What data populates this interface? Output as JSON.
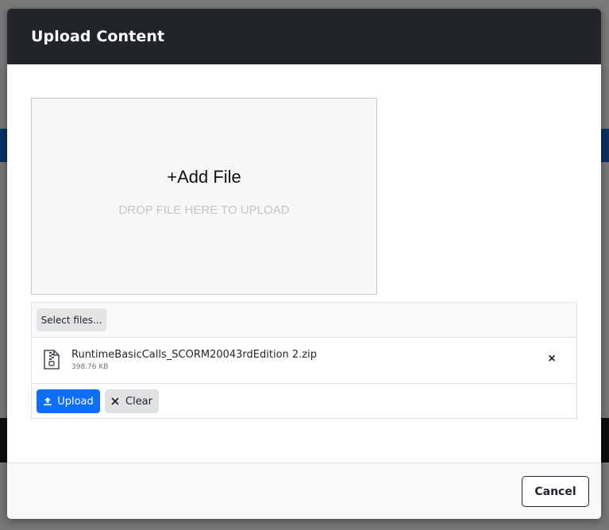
{
  "modal": {
    "title": "Upload Content"
  },
  "dropzone": {
    "add_label": "+Add File",
    "hint": "DROP FILE HERE TO UPLOAD"
  },
  "uploader": {
    "select_label": "Select files...",
    "files": [
      {
        "name": "RuntimeBasicCalls_SCORM20043rdEdition 2.zip",
        "size": "398.76 KB",
        "icon": "zip-file-icon",
        "remove_symbol": "×"
      }
    ],
    "upload_label": "Upload",
    "clear_label": "Clear"
  },
  "footer": {
    "cancel_label": "Cancel"
  },
  "colors": {
    "header_bg": "#212529",
    "primary": "#0d6efd",
    "secondary_bg": "#dfe1e3"
  }
}
